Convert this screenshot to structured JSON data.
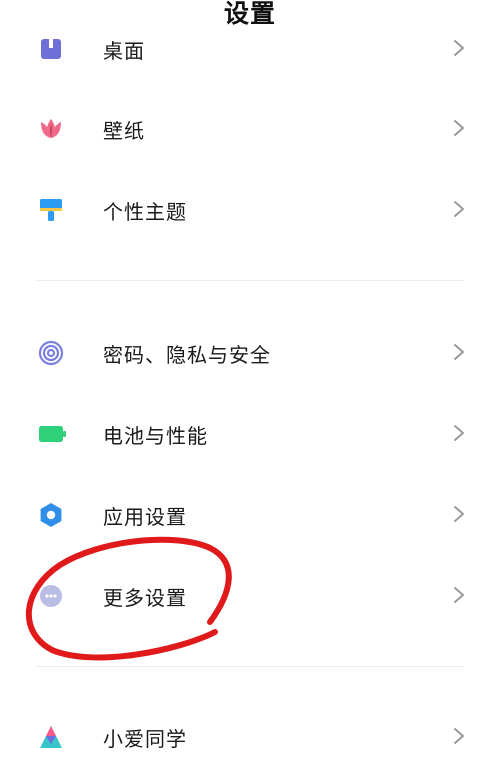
{
  "header": {
    "title": "设置"
  },
  "groups": [
    {
      "items": [
        {
          "id": "desktop",
          "label": "桌面",
          "icon": "desktop-icon",
          "color": "#6f6fd8"
        },
        {
          "id": "wallpaper",
          "label": "壁纸",
          "icon": "tulip-icon",
          "color": "#f06b8a"
        },
        {
          "id": "theme",
          "label": "个性主题",
          "icon": "paintbrush-icon",
          "color": "#2b9cf2"
        }
      ]
    },
    {
      "items": [
        {
          "id": "security",
          "label": "密码、隐私与安全",
          "icon": "fingerprint-icon",
          "color": "#7b7fe0"
        },
        {
          "id": "battery",
          "label": "电池与性能",
          "icon": "battery-icon",
          "color": "#2fd07a"
        },
        {
          "id": "apps",
          "label": "应用设置",
          "icon": "gear-icon",
          "color": "#2e8ee8"
        },
        {
          "id": "more",
          "label": "更多设置",
          "icon": "more-dots-icon",
          "color": "#b9bde6"
        }
      ]
    },
    {
      "items": [
        {
          "id": "xiaoai",
          "label": "小爱同学",
          "icon": "xiaoai-icon",
          "color": "#37c5c9"
        }
      ]
    }
  ],
  "annotation": {
    "color": "#e0191b"
  }
}
